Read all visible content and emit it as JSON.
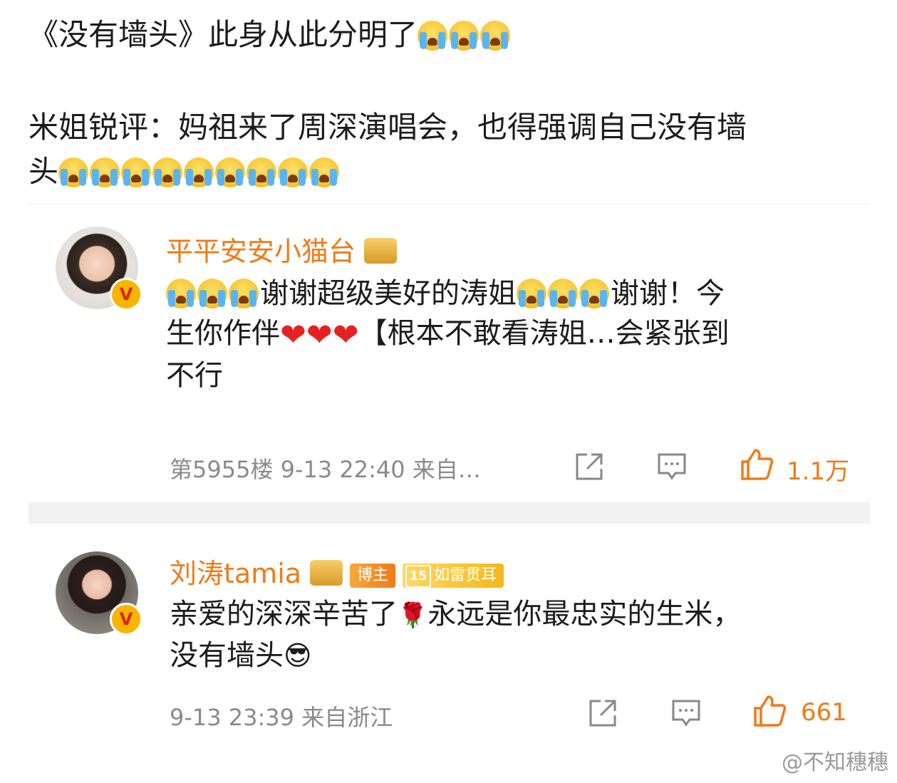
{
  "post": {
    "line1": "《没有墙头》此身从此分明了",
    "line2": "米姐锐评：妈祖来了周深演唱会，也得强调自己没有墙",
    "line3": "头"
  },
  "comments": [
    {
      "username": "平平安安小猫台",
      "text_part1": "谢谢超级美好的涛姐",
      "text_part2": "谢谢！今",
      "text_part3": "生你作伴",
      "text_part4": "【根本不敢看涛姐…会紧张到",
      "text_part5": "不行",
      "floor": "第5955楼",
      "time": "9-13 22:40",
      "source": "来自…",
      "likes": "1.1万"
    },
    {
      "username": "刘涛tamia",
      "tag_blogger": "博主",
      "fan_level": "15",
      "tag_fan": "如雷贯耳",
      "text_part1": "亲爱的深深辛苦了",
      "text_part2": "永远是你最忠实的生米，",
      "text_part3": "没有墙头",
      "time": "9-13 23:39",
      "source": "来自浙江",
      "likes": "661"
    }
  ],
  "icons": {
    "verified": "V",
    "rose": "🌹",
    "sunglasses": "😎"
  },
  "colors": {
    "accent": "#f07a18",
    "verified": "#f7b500"
  },
  "watermark": "@不知穗穗"
}
